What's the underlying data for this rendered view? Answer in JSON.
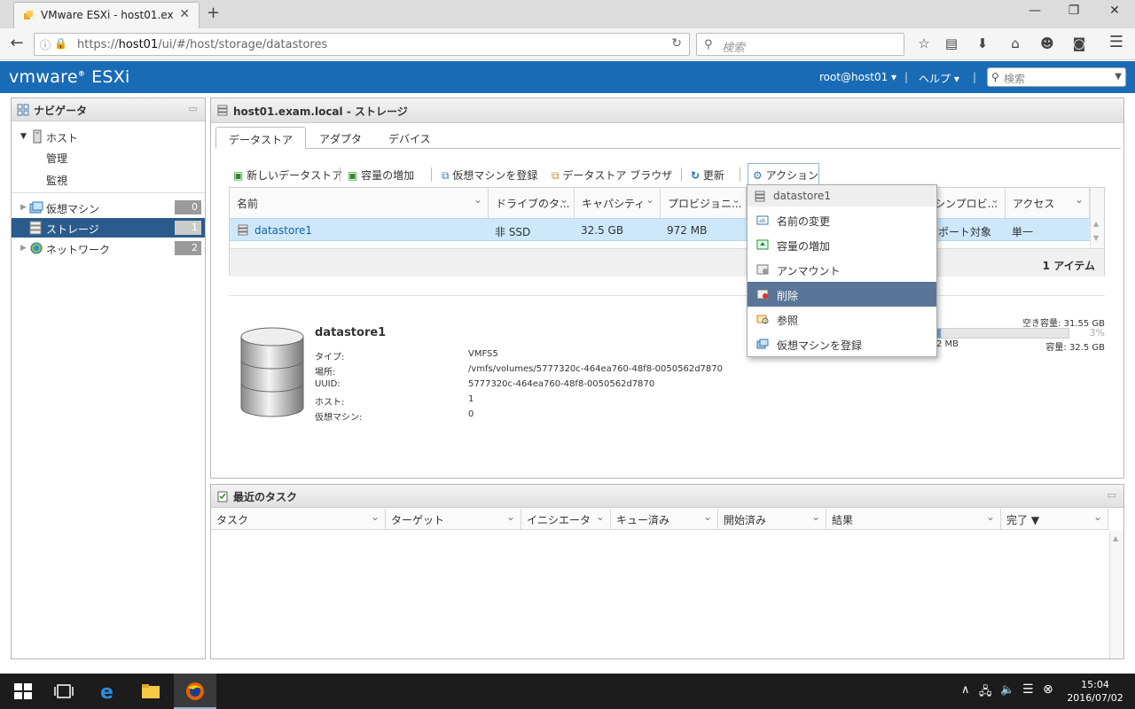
{
  "browser": {
    "tab_title": "VMware ESXi - host01.exa...",
    "url_prefix": "https://",
    "url_host": "host01",
    "url_path": "/ui/#/host/storage/datastores",
    "search_placeholder": "検索"
  },
  "header": {
    "logo_vm": "vmware",
    "logo_product": "ESXi",
    "user": "root@host01 ▾",
    "help": "ヘルプ ▾",
    "search_placeholder": "検索"
  },
  "navigator": {
    "title": "ナビゲータ",
    "host": "ホスト",
    "manage": "管理",
    "monitor": "監視",
    "items": [
      {
        "label": "仮想マシン",
        "count": "0"
      },
      {
        "label": "ストレージ",
        "count": "1"
      },
      {
        "label": "ネットワーク",
        "count": "2"
      }
    ]
  },
  "main": {
    "title": "host01.exam.local - ストレージ",
    "tabs": [
      "データストア",
      "アダプタ",
      "デバイス"
    ],
    "toolbar": {
      "new_datastore": "新しいデータストア",
      "increase": "容量の増加",
      "register_vm": "仮想マシンを登録",
      "browser": "データストア ブラウザ",
      "refresh": "更新",
      "actions": "アクション"
    },
    "columns": [
      "名前",
      "ドライブのタ...",
      "キャパシティ",
      "プロビジョニ...",
      "シンプロビ...",
      "アクセス"
    ],
    "row": {
      "name": "datastore1",
      "drive": "非 SSD",
      "capacity": "32.5 GB",
      "provisioned": "972 MB",
      "thin": "サポート対象",
      "access": "単一"
    },
    "footer_count": "1 アイテム"
  },
  "detail": {
    "name": "datastore1",
    "labels": [
      "タイプ:",
      "場所:",
      "UUID:",
      "ホスト:",
      "仮想マシン:"
    ],
    "values": [
      "VMFS5",
      "/vmfs/volumes/5777320c-464ea760-48f8-0050562d7870",
      "5777320c-464ea760-48f8-0050562d7870",
      "1",
      "0"
    ],
    "free": "空き容量: 31.55 GB",
    "percent": "3%",
    "used": "2 MB",
    "capacity": "容量: 32.5 GB",
    "usage_fraction": 0.03
  },
  "menu": {
    "header": "datastore1",
    "items": [
      "名前の変更",
      "容量の増加",
      "アンマウント",
      "削除",
      "参照",
      "仮想マシンを登録"
    ]
  },
  "tasks": {
    "title": "最近のタスク",
    "columns": [
      "タスク",
      "ターゲット",
      "イニシエータ",
      "キュー済み",
      "開始済み",
      "結果",
      "完了 ▼"
    ]
  },
  "clock": {
    "time": "15:04",
    "date": "2016/07/02"
  },
  "colors": {
    "header": "#1a6bb5",
    "selected": "#2b5b8c",
    "menu_highlight": "#5a7597",
    "row_selected": "#cde8fb"
  }
}
